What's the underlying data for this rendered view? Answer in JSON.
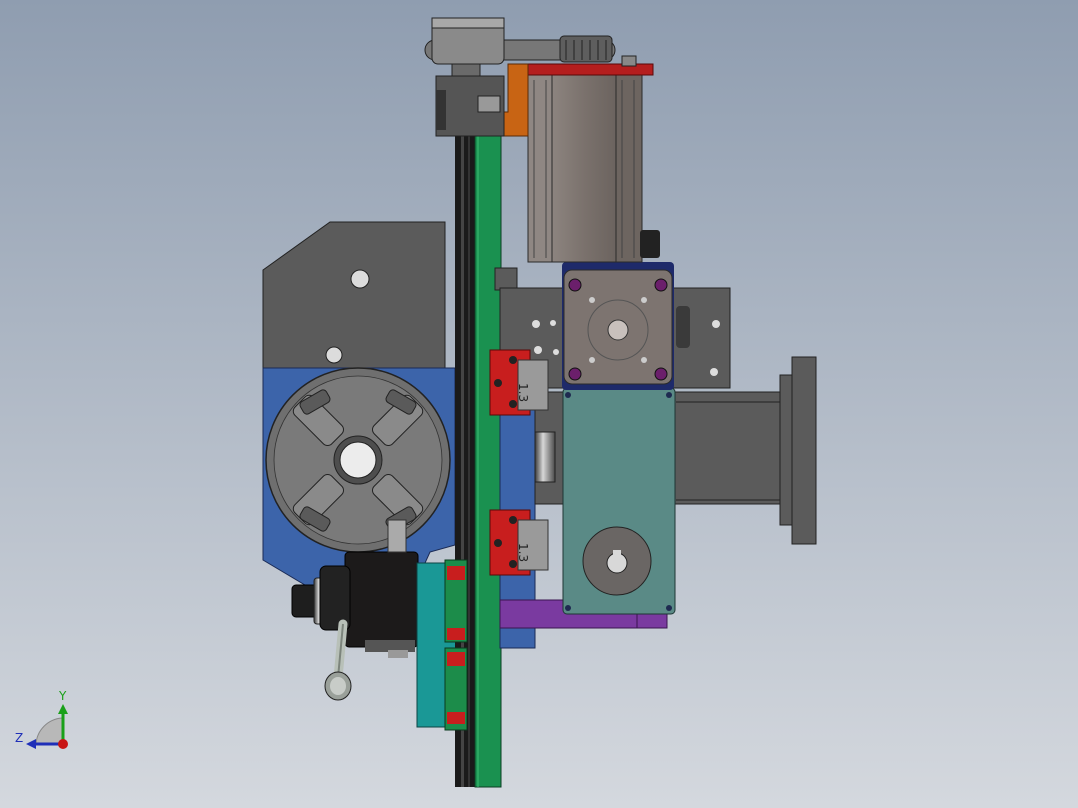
{
  "viewport": {
    "background_top": "#8f9db0",
    "background_bottom": "#d4d8de"
  },
  "triad": {
    "y_label": "Y",
    "z_label": "Z",
    "y_color": "#19a019",
    "z_color": "#1f2fb8",
    "x_color": "#c81414"
  },
  "slide_labels": {
    "upper": "1.3",
    "lower": "1.3"
  },
  "colors": {
    "housing": "#5b5b5b",
    "chuck_base": "#3c64aa",
    "chuck": "#6f6f6f",
    "rail": "#1a9150",
    "bearing_red": "#c81e1e",
    "motor": "#7a716c",
    "stepper": "#7d7470",
    "gearbox": "#5a8a86",
    "bracket_purple": "#7a3aa0",
    "plate_teal": "#1a9896",
    "orange_bracket": "#c86414",
    "red_plate": "#b41e1e"
  }
}
